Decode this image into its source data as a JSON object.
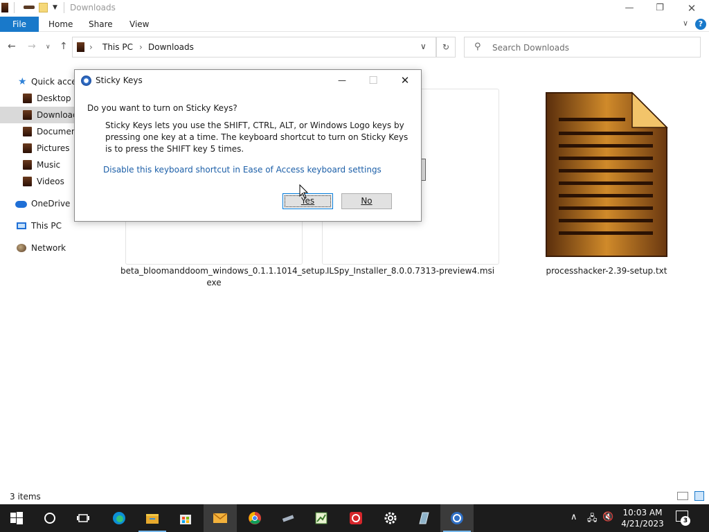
{
  "window": {
    "title": "Downloads",
    "ribbon_tabs": {
      "file": "File",
      "home": "Home",
      "share": "Share",
      "view": "View"
    },
    "minimize_glyph": "—",
    "restore_glyph": "❐",
    "close_glyph": "✕",
    "help_glyph": "?"
  },
  "address": {
    "crumbs": [
      "This PC",
      "Downloads"
    ],
    "search_placeholder": "Search Downloads"
  },
  "navpane": {
    "items": [
      {
        "label": "Quick access",
        "icon": "star-icon"
      },
      {
        "label": "Desktop",
        "icon": "folder-icon"
      },
      {
        "label": "Downloads",
        "icon": "folder-icon",
        "selected": true
      },
      {
        "label": "Documents",
        "icon": "folder-icon"
      },
      {
        "label": "Pictures",
        "icon": "folder-icon"
      },
      {
        "label": "Music",
        "icon": "folder-icon"
      },
      {
        "label": "Videos",
        "icon": "folder-icon"
      },
      {
        "label": "OneDrive",
        "icon": "onedrive-icon"
      },
      {
        "label": "This PC",
        "icon": "computer-icon"
      },
      {
        "label": "Network",
        "icon": "network-icon"
      }
    ]
  },
  "files": [
    {
      "name_line1": "beta_bloomanddoom_windows_0.1.1.1014_setup.",
      "name_line2": "exe"
    },
    {
      "name_line1": "ILSpy_Installer_8.0.0.7313-preview4.msi",
      "name_line2": ""
    },
    {
      "name_line1": "processhacker-2.39-setup.txt",
      "name_line2": ""
    }
  ],
  "status": {
    "item_count": "3 items"
  },
  "dialog": {
    "title": "Sticky Keys",
    "question": "Do you want to turn on Sticky Keys?",
    "body": "Sticky Keys lets you use the SHIFT, CTRL, ALT, or Windows Logo keys by pressing one key at a time. The keyboard shortcut to turn on Sticky Keys is to press the SHIFT key 5 times.",
    "link": "Disable this keyboard shortcut in Ease of Access keyboard settings",
    "yes_label": "Yes",
    "no_label": "No",
    "minimize_glyph": "—",
    "maximize_glyph": "☐",
    "close_glyph": "✕"
  },
  "taskbar": {
    "time": "10:03 AM",
    "date": "4/21/2023",
    "notification_count": "3",
    "accent": "#76b9ed"
  }
}
